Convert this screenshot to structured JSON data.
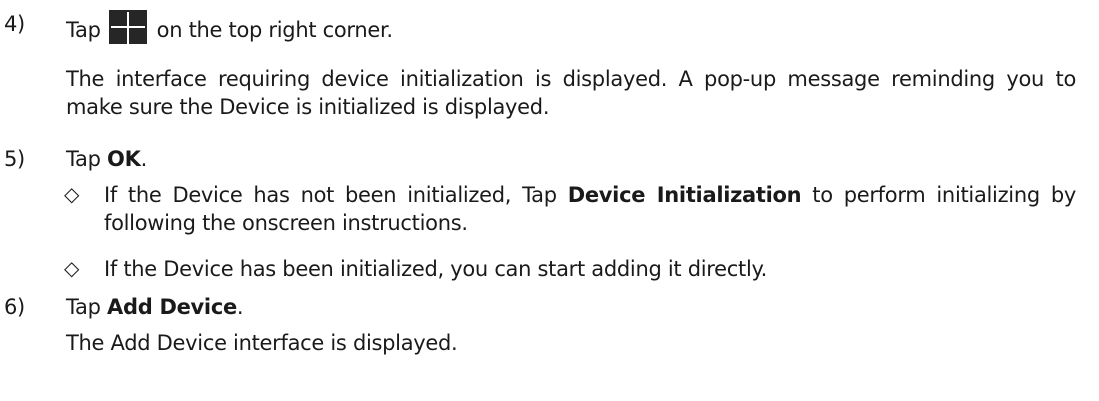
{
  "steps": [
    {
      "number": "4)",
      "before_icon": "Tap",
      "icon": "plus-icon",
      "after_icon": "on the top right corner.",
      "description": "The interface requiring device initialization is displayed. A pop-up message reminding you to make sure the Device is initialized is displayed."
    },
    {
      "number": "5)",
      "prefix": "Tap ",
      "bold": "OK",
      "suffix": ".",
      "bullets": [
        {
          "symbol": "◇",
          "pre": "If the Device has not been initialized, Tap ",
          "bold": "Device Initialization",
          "post": " to perform initializing by following the onscreen instructions."
        },
        {
          "symbol": "◇",
          "pre": "If the Device has been initialized, you can start adding it directly.",
          "bold": "",
          "post": ""
        }
      ]
    },
    {
      "number": "6)",
      "prefix": "Tap ",
      "bold": "Add Device",
      "suffix": ".",
      "description": "The Add Device interface is displayed."
    }
  ]
}
